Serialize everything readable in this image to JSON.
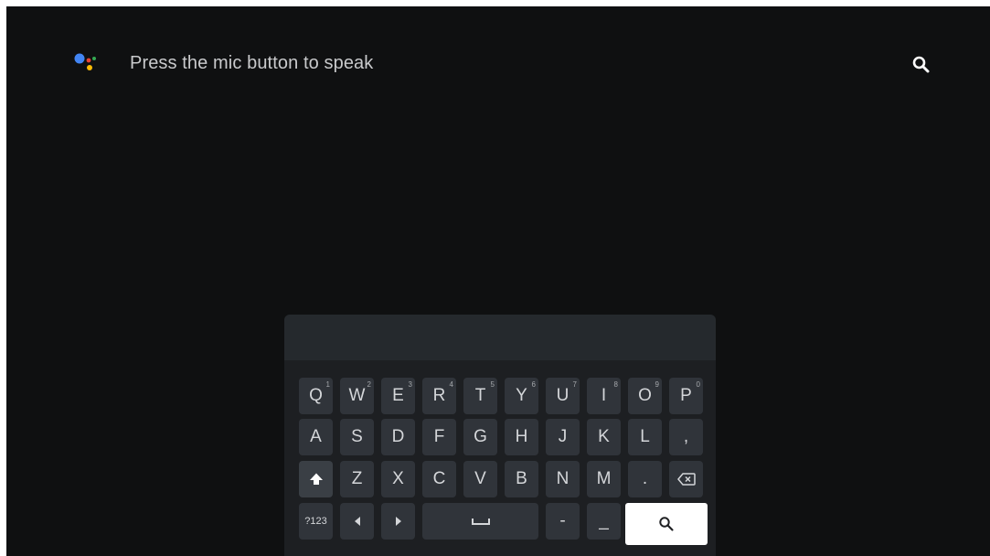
{
  "header": {
    "prompt": "Press the mic button to speak",
    "assistant_icon": "google-assistant-icon",
    "search_icon": "search-icon"
  },
  "keyboard": {
    "row1": [
      {
        "label": "Q",
        "sup": "1"
      },
      {
        "label": "W",
        "sup": "2"
      },
      {
        "label": "E",
        "sup": "3"
      },
      {
        "label": "R",
        "sup": "4"
      },
      {
        "label": "T",
        "sup": "5"
      },
      {
        "label": "Y",
        "sup": "6"
      },
      {
        "label": "U",
        "sup": "7"
      },
      {
        "label": "I",
        "sup": "8"
      },
      {
        "label": "O",
        "sup": "9"
      },
      {
        "label": "P",
        "sup": "0"
      }
    ],
    "row2": [
      "A",
      "S",
      "D",
      "F",
      "G",
      "H",
      "J",
      "K",
      "L",
      ","
    ],
    "row3": {
      "shift_icon": "shift-icon",
      "letters": [
        "Z",
        "X",
        "C",
        "V",
        "B",
        "N",
        "M",
        "."
      ],
      "backspace_icon": "backspace-icon"
    },
    "row4": {
      "symbols_label": "?123",
      "left_icon": "cursor-left-icon",
      "right_icon": "cursor-right-icon",
      "space_icon": "space-icon",
      "dash_label": "-",
      "underscore_label": "_",
      "search_icon": "search-icon"
    }
  },
  "colors": {
    "background": "#0f1011",
    "key": "#30343a",
    "key_text": "#d4d6d9",
    "search_key": "#ffffff",
    "assistant_blue": "#4285f4",
    "assistant_red": "#ea4335",
    "assistant_yellow": "#fbbc05",
    "assistant_green": "#34a853"
  }
}
